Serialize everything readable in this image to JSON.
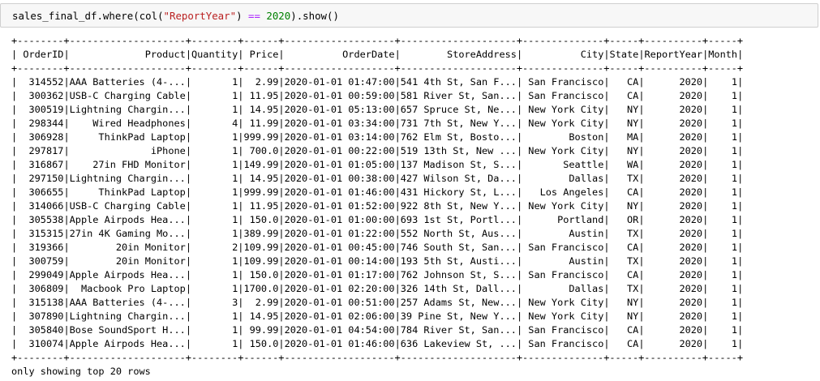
{
  "input_cell": {
    "var": "sales_final_df",
    "method": "where",
    "func": "col",
    "column_literal": "\"ReportYear\"",
    "operator": "==",
    "number": "2020",
    "show_call": "show"
  },
  "table": {
    "columns": [
      "OrderID",
      "Product",
      "Quantity",
      "Price",
      "OrderDate",
      "StoreAddress",
      "City",
      "State",
      "ReportYear",
      "Month"
    ],
    "widths": [
      8,
      20,
      8,
      6,
      19,
      20,
      14,
      5,
      10,
      5
    ],
    "align": [
      "right",
      "right",
      "right",
      "right",
      "right",
      "right",
      "right",
      "right",
      "right",
      "right"
    ],
    "rows": [
      [
        "314552",
        "AAA Batteries (4-...",
        "1",
        "2.99",
        "2020-01-01 01:47:00",
        "541 4th St, San F...",
        "San Francisco",
        "CA",
        "2020",
        "1"
      ],
      [
        "300362",
        "USB-C Charging Cable",
        "1",
        "11.95",
        "2020-01-01 00:59:00",
        "581 River St, San...",
        "San Francisco",
        "CA",
        "2020",
        "1"
      ],
      [
        "300519",
        "Lightning Chargin...",
        "1",
        "14.95",
        "2020-01-01 05:13:00",
        "657 Spruce St, Ne...",
        "New York City",
        "NY",
        "2020",
        "1"
      ],
      [
        "298344",
        "Wired Headphones",
        "4",
        "11.99",
        "2020-01-01 03:34:00",
        "731 7th St, New Y...",
        "New York City",
        "NY",
        "2020",
        "1"
      ],
      [
        "306928",
        "ThinkPad Laptop",
        "1",
        "999.99",
        "2020-01-01 03:14:00",
        "762 Elm St, Bosto...",
        "Boston",
        "MA",
        "2020",
        "1"
      ],
      [
        "297817",
        "iPhone",
        "1",
        "700.0",
        "2020-01-01 00:22:00",
        "519 13th St, New ...",
        "New York City",
        "NY",
        "2020",
        "1"
      ],
      [
        "316867",
        "27in FHD Monitor",
        "1",
        "149.99",
        "2020-01-01 01:05:00",
        "137 Madison St, S...",
        "Seattle",
        "WA",
        "2020",
        "1"
      ],
      [
        "297150",
        "Lightning Chargin...",
        "1",
        "14.95",
        "2020-01-01 00:38:00",
        "427 Wilson St, Da...",
        "Dallas",
        "TX",
        "2020",
        "1"
      ],
      [
        "306655",
        "ThinkPad Laptop",
        "1",
        "999.99",
        "2020-01-01 01:46:00",
        "431 Hickory St, L...",
        "Los Angeles",
        "CA",
        "2020",
        "1"
      ],
      [
        "314066",
        "USB-C Charging Cable",
        "1",
        "11.95",
        "2020-01-01 01:52:00",
        "922 8th St, New Y...",
        "New York City",
        "NY",
        "2020",
        "1"
      ],
      [
        "305538",
        "Apple Airpods Hea...",
        "1",
        "150.0",
        "2020-01-01 01:00:00",
        "693 1st St, Portl...",
        "Portland",
        "OR",
        "2020",
        "1"
      ],
      [
        "315315",
        "27in 4K Gaming Mo...",
        "1",
        "389.99",
        "2020-01-01 01:22:00",
        "552 North St, Aus...",
        "Austin",
        "TX",
        "2020",
        "1"
      ],
      [
        "319366",
        "20in Monitor",
        "2",
        "109.99",
        "2020-01-01 00:45:00",
        "746 South St, San...",
        "San Francisco",
        "CA",
        "2020",
        "1"
      ],
      [
        "300759",
        "20in Monitor",
        "1",
        "109.99",
        "2020-01-01 00:14:00",
        "193 5th St, Austi...",
        "Austin",
        "TX",
        "2020",
        "1"
      ],
      [
        "299049",
        "Apple Airpods Hea...",
        "1",
        "150.0",
        "2020-01-01 01:17:00",
        "762 Johnson St, S...",
        "San Francisco",
        "CA",
        "2020",
        "1"
      ],
      [
        "306809",
        "Macbook Pro Laptop",
        "1",
        "1700.0",
        "2020-01-01 02:20:00",
        "326 14th St, Dall...",
        "Dallas",
        "TX",
        "2020",
        "1"
      ],
      [
        "315138",
        "AAA Batteries (4-...",
        "3",
        "2.99",
        "2020-01-01 00:51:00",
        "257 Adams St, New...",
        "New York City",
        "NY",
        "2020",
        "1"
      ],
      [
        "307890",
        "Lightning Chargin...",
        "1",
        "14.95",
        "2020-01-01 02:06:00",
        "39 Pine St, New Y...",
        "New York City",
        "NY",
        "2020",
        "1"
      ],
      [
        "305840",
        "Bose SoundSport H...",
        "1",
        "99.99",
        "2020-01-01 04:54:00",
        "784 River St, San...",
        "San Francisco",
        "CA",
        "2020",
        "1"
      ],
      [
        "310074",
        "Apple Airpods Hea...",
        "1",
        "150.0",
        "2020-01-01 01:46:00",
        "636 Lakeview St, ...",
        "San Francisco",
        "CA",
        "2020",
        "1"
      ]
    ]
  },
  "footer": "only showing top 20 rows"
}
